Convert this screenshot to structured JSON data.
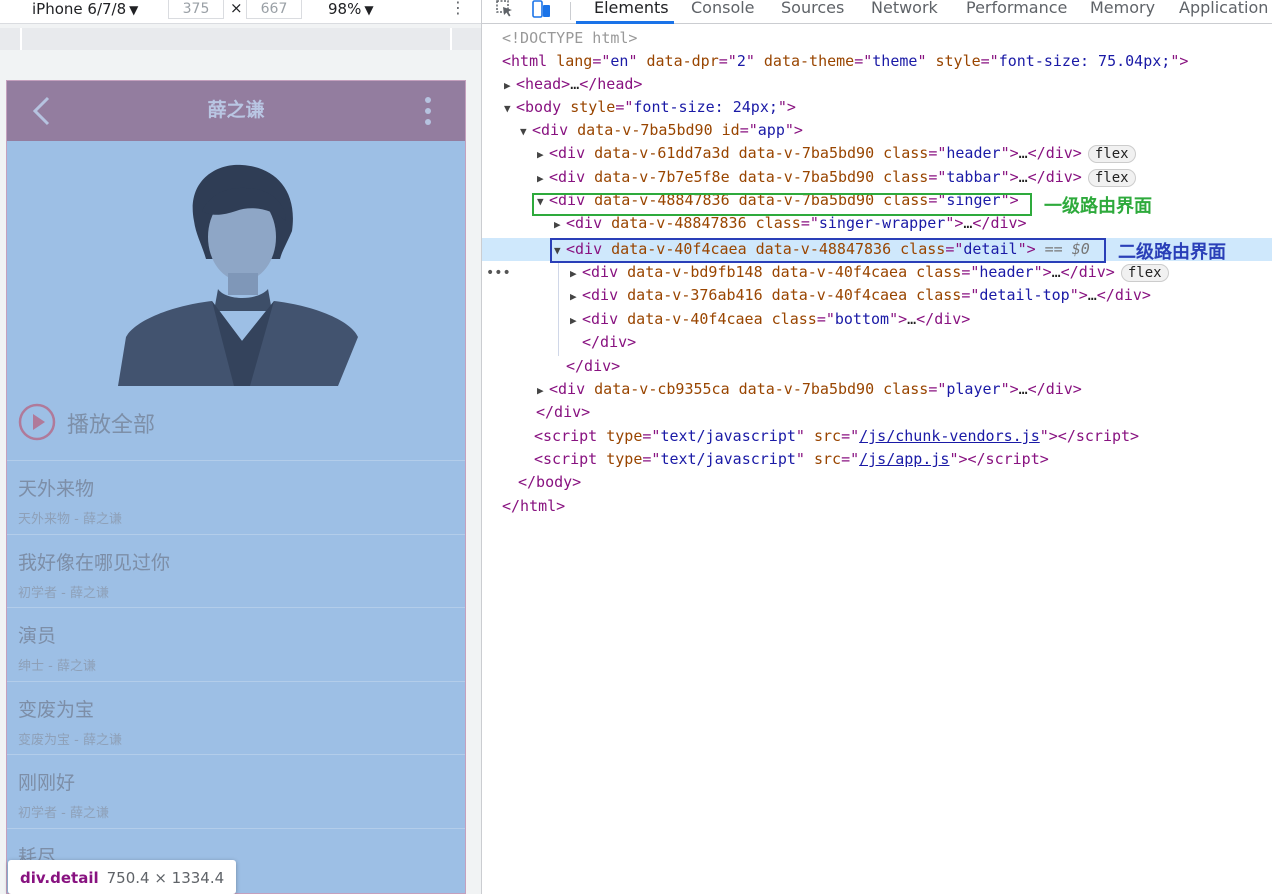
{
  "device_toolbar": {
    "device": "iPhone 6/7/8",
    "width": "375",
    "height": "667",
    "times": "×",
    "zoom": "98%"
  },
  "phone": {
    "title": "薛之谦",
    "play_all": "播放全部",
    "songs": [
      {
        "title": "天外来物",
        "subtitle": "天外来物 - 薛之谦"
      },
      {
        "title": "我好像在哪见过你",
        "subtitle": "初学者 - 薛之谦"
      },
      {
        "title": "演员",
        "subtitle": "绅士 - 薛之谦"
      },
      {
        "title": "变废为宝",
        "subtitle": "变废为宝 - 薛之谦"
      },
      {
        "title": "刚刚好",
        "subtitle": "初学者 - 薛之谦"
      },
      {
        "title": "耗尽",
        "subtitle": ""
      }
    ]
  },
  "tooltip": {
    "tag": "div.detail",
    "size": "750.4 × 1334.4"
  },
  "devtools": {
    "tabs": [
      "Elements",
      "Console",
      "Sources",
      "Network",
      "Performance",
      "Memory",
      "Application"
    ],
    "active_tab": "Elements",
    "annotations": {
      "level1": "一级路由界面",
      "level2": "二级路由界面"
    },
    "badge": "flex",
    "selected_suffix": "== $0",
    "links": {
      "vendors": "/js/chunk-vendors.js",
      "app": "/js/app.js"
    }
  },
  "colors": {
    "level1_box": "#2eaa3c",
    "level2_box": "#2a3fb8",
    "tab_underline": "#1a73e8"
  }
}
